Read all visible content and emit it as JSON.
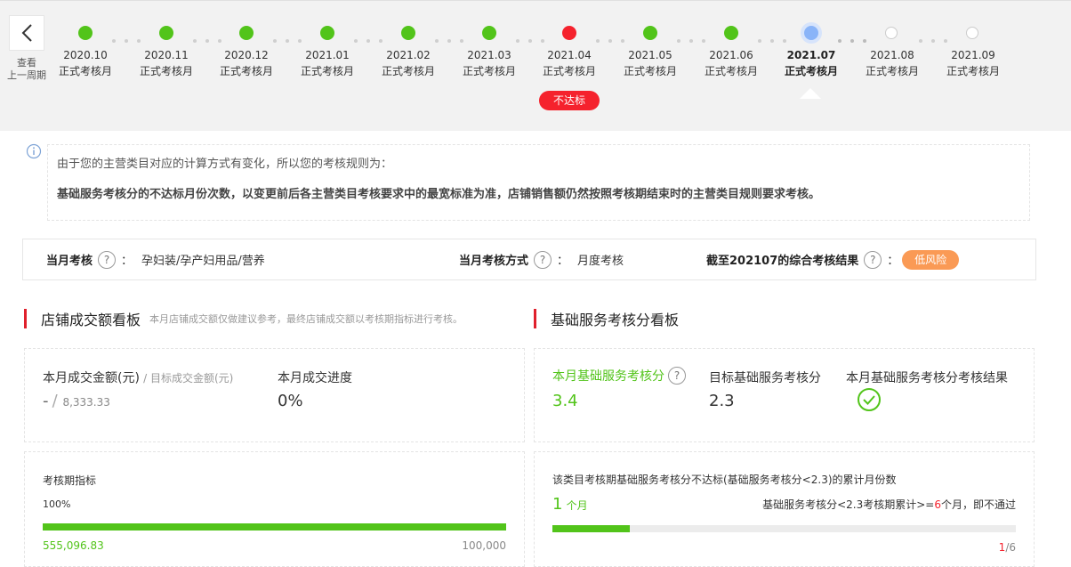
{
  "timeline": {
    "prev_label_line1": "查看",
    "prev_label_line2": "上一周期",
    "months": [
      {
        "date": "2020.10",
        "type": "正式考核月",
        "status": "ok"
      },
      {
        "date": "2020.11",
        "type": "正式考核月",
        "status": "ok"
      },
      {
        "date": "2020.12",
        "type": "正式考核月",
        "status": "ok"
      },
      {
        "date": "2021.01",
        "type": "正式考核月",
        "status": "ok"
      },
      {
        "date": "2021.02",
        "type": "正式考核月",
        "status": "ok"
      },
      {
        "date": "2021.03",
        "type": "正式考核月",
        "status": "ok"
      },
      {
        "date": "2021.04",
        "type": "正式考核月",
        "status": "bad"
      },
      {
        "date": "2021.05",
        "type": "正式考核月",
        "status": "ok"
      },
      {
        "date": "2021.06",
        "type": "正式考核月",
        "status": "ok"
      },
      {
        "date": "2021.07",
        "type": "正式考核月",
        "status": "current"
      },
      {
        "date": "2021.08",
        "type": "正式考核月",
        "status": "future"
      },
      {
        "date": "2021.09",
        "type": "正式考核月",
        "status": "future"
      }
    ],
    "fail_badge": "不达标"
  },
  "notice": {
    "line1": "由于您的主营类目对应的计算方式有变化，所以您的考核规则为：",
    "line2": "基础服务考核分的不达标月份次数，以变更前后各主营类目考核要求中的最宽标准为准，店铺销售额仍然按照考核期结束时的主营类目规则要求考核。"
  },
  "summary": {
    "month_label": "当月考核",
    "colon": "：",
    "month_value": "孕妇装/孕产妇用品/营养",
    "method_label": "当月考核方式",
    "method_value": "月度考核",
    "result_label": "截至202107的综合考核结果",
    "result_value": "低风险"
  },
  "sales": {
    "title": "店铺成交额看板",
    "subtitle": "本月店铺成交额仅做建议参考，最终店铺成交额以考核期指标进行考核。",
    "amount_label": "本月成交金额(元)",
    "target_label": "目标成交金额(元)",
    "amount_value": "-",
    "target_value": "8,333.33",
    "progress_label": "本月成交进度",
    "progress_value": "0%",
    "period_label": "考核期指标",
    "period_percent": "100%",
    "period_current": "555,096.83",
    "period_target": "100,000",
    "period_fill": 1.0
  },
  "service": {
    "title": "基础服务考核分看板",
    "score_label": "本月基础服务考核分",
    "score_value": "3.4",
    "target_label": "目标基础服务考核分",
    "target_value": "2.3",
    "result_label": "本月基础服务考核分考核结果",
    "fail_desc": "该类目考核期基础服务考核分不达标(基础服务考核分<2.3)的累计月份数",
    "fail_count": "1",
    "fail_unit": "个月",
    "rule_prefix": "基础服务考核分<2.3考核期累计>=",
    "rule_num": "6",
    "rule_suffix": "个月，即不通过",
    "ratio_num": "1",
    "ratio_den": "/6",
    "fail_fill": 0.1667
  },
  "colors": {
    "ok": "#52c41a",
    "bad": "#f5222d",
    "current": "#8ab4f8",
    "risk": "#fa9a55",
    "accent_bar": "#e0202c"
  }
}
